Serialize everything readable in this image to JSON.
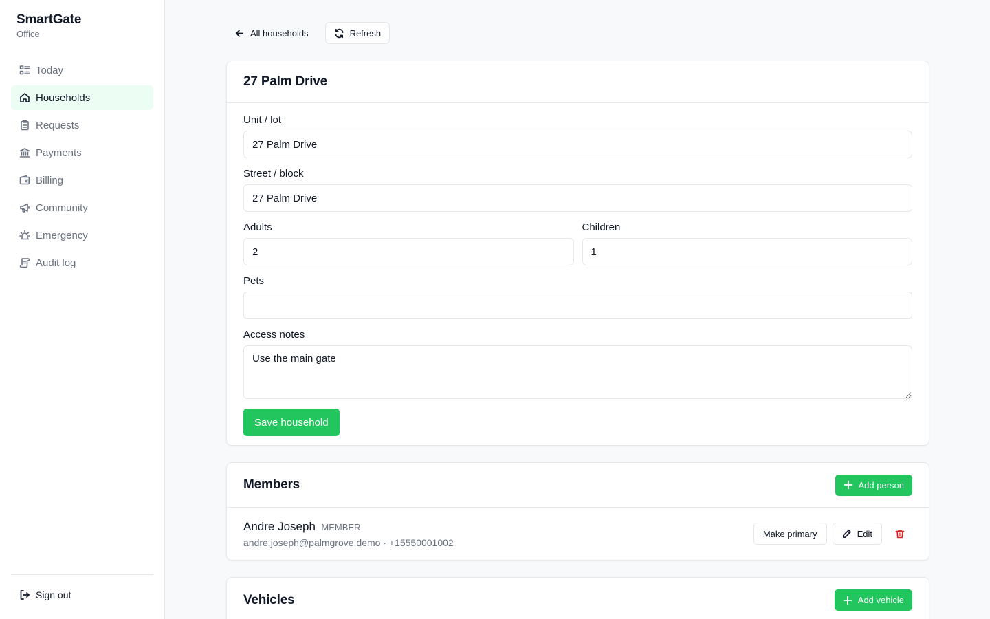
{
  "app": {
    "name": "SmartGate",
    "subtitle": "Office"
  },
  "sidebar": {
    "items": [
      {
        "label": "Today",
        "icon": "list-icon"
      },
      {
        "label": "Households",
        "icon": "home-icon",
        "active": true
      },
      {
        "label": "Requests",
        "icon": "clipboard-icon"
      },
      {
        "label": "Payments",
        "icon": "bank-icon"
      },
      {
        "label": "Billing",
        "icon": "wallet-icon"
      },
      {
        "label": "Community",
        "icon": "megaphone-icon"
      },
      {
        "label": "Emergency",
        "icon": "siren-icon"
      },
      {
        "label": "Audit log",
        "icon": "scroll-icon"
      }
    ],
    "sign_out": "Sign out"
  },
  "topbar": {
    "back_label": "All households",
    "refresh_label": "Refresh"
  },
  "household": {
    "title": "27 Palm Drive",
    "unit_label": "Unit / lot",
    "unit_value": "27 Palm Drive",
    "street_label": "Street / block",
    "street_value": "27 Palm Drive",
    "adults_label": "Adults",
    "adults_value": "2",
    "children_label": "Children",
    "children_value": "1",
    "pets_label": "Pets",
    "pets_value": "",
    "notes_label": "Access notes",
    "notes_value": "Use the main gate",
    "save_label": "Save household"
  },
  "members": {
    "title": "Members",
    "add_label": "Add person",
    "list": [
      {
        "name": "Andre Joseph",
        "role": "MEMBER",
        "contact": "andre.joseph@palmgrove.demo · +15550001002",
        "make_primary_label": "Make primary",
        "edit_label": "Edit"
      }
    ]
  },
  "vehicles": {
    "title": "Vehicles",
    "add_label": "Add vehicle"
  },
  "colors": {
    "accent": "#22c55e",
    "active_bg": "#ecfdf3",
    "danger": "#dc2626",
    "muted": "#6b7280"
  }
}
